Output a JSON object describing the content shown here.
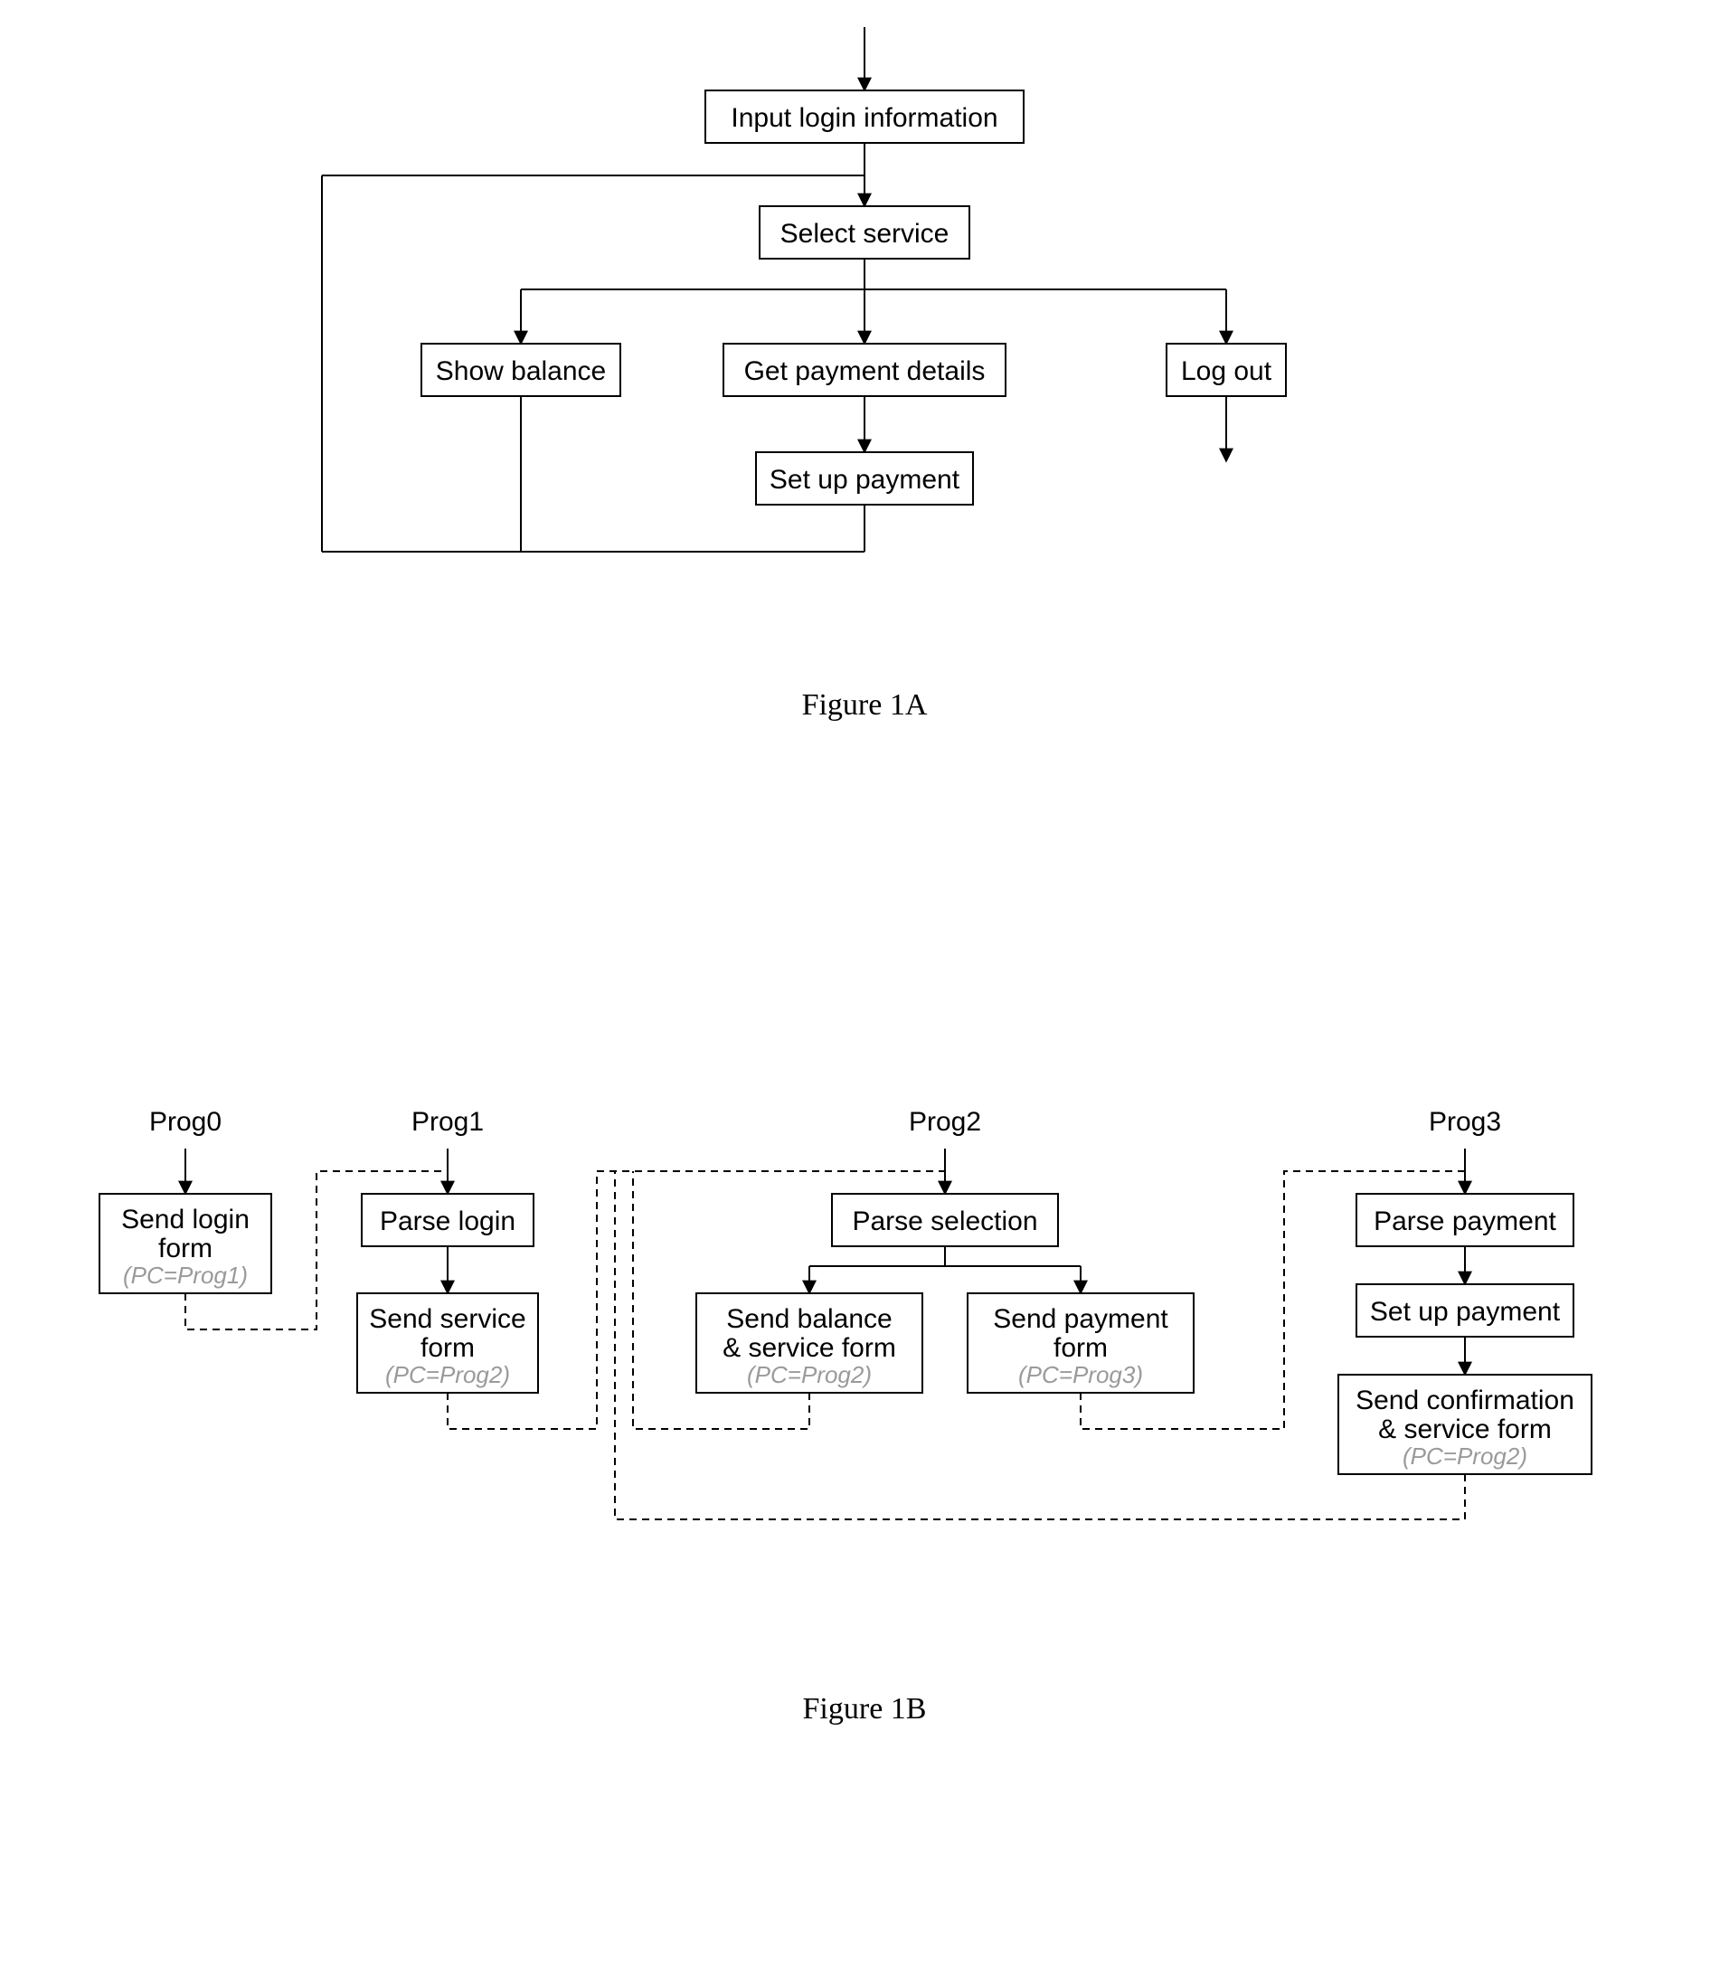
{
  "figA": {
    "caption": "Figure 1A",
    "nodes": {
      "login": "Input login information",
      "select": "Select service",
      "balance": "Show balance",
      "payDet": "Get payment details",
      "setup": "Set up payment",
      "logout": "Log out"
    }
  },
  "figB": {
    "caption": "Figure 1B",
    "progs": {
      "p0": "Prog0",
      "p1": "Prog1",
      "p2": "Prog2",
      "p3": "Prog3"
    },
    "nodes": {
      "p0_sendLogin": {
        "l1": "Send login",
        "l2": "form",
        "pc": "(PC=Prog1)"
      },
      "p1_parse": {
        "l1": "Parse login"
      },
      "p1_sendSvc": {
        "l1": "Send service",
        "l2": "form",
        "pc": "(PC=Prog2)"
      },
      "p2_parse": {
        "l1": "Parse selection"
      },
      "p2_balance": {
        "l1": "Send balance",
        "l2": "& service form",
        "pc": "(PC=Prog2)"
      },
      "p2_payForm": {
        "l1": "Send payment",
        "l2": "form",
        "pc": "(PC=Prog3)"
      },
      "p3_parse": {
        "l1": "Parse payment"
      },
      "p3_setup": {
        "l1": "Set up payment"
      },
      "p3_conf": {
        "l1": "Send confirmation",
        "l2": "& service form",
        "pc": "(PC=Prog2)"
      }
    }
  },
  "chart_data": [
    {
      "type": "flowchart",
      "figure": "1A",
      "nodes": [
        {
          "id": "login",
          "label": "Input login information"
        },
        {
          "id": "select",
          "label": "Select service"
        },
        {
          "id": "balance",
          "label": "Show balance"
        },
        {
          "id": "payDet",
          "label": "Get payment details"
        },
        {
          "id": "setup",
          "label": "Set up payment"
        },
        {
          "id": "logout",
          "label": "Log out"
        }
      ],
      "edges": [
        {
          "from": "_start",
          "to": "login"
        },
        {
          "from": "login",
          "to": "select"
        },
        {
          "from": "select",
          "to": "balance"
        },
        {
          "from": "select",
          "to": "payDet"
        },
        {
          "from": "select",
          "to": "logout"
        },
        {
          "from": "payDet",
          "to": "setup"
        },
        {
          "from": "balance",
          "to": "select",
          "loop_back": true
        },
        {
          "from": "setup",
          "to": "select",
          "loop_back": true
        },
        {
          "from": "logout",
          "to": "_end"
        }
      ]
    },
    {
      "type": "flowchart",
      "figure": "1B",
      "groups": [
        "Prog0",
        "Prog1",
        "Prog2",
        "Prog3"
      ],
      "nodes": [
        {
          "id": "p0_sendLogin",
          "group": "Prog0",
          "label": "Send login form",
          "pc": "Prog1"
        },
        {
          "id": "p1_parse",
          "group": "Prog1",
          "label": "Parse login"
        },
        {
          "id": "p1_sendSvc",
          "group": "Prog1",
          "label": "Send service form",
          "pc": "Prog2"
        },
        {
          "id": "p2_parse",
          "group": "Prog2",
          "label": "Parse selection"
        },
        {
          "id": "p2_balance",
          "group": "Prog2",
          "label": "Send balance & service form",
          "pc": "Prog2"
        },
        {
          "id": "p2_payForm",
          "group": "Prog2",
          "label": "Send payment form",
          "pc": "Prog3"
        },
        {
          "id": "p3_parse",
          "group": "Prog3",
          "label": "Parse payment"
        },
        {
          "id": "p3_setup",
          "group": "Prog3",
          "label": "Set up payment"
        },
        {
          "id": "p3_conf",
          "group": "Prog3",
          "label": "Send confirmation & service form",
          "pc": "Prog2"
        }
      ],
      "edges": [
        {
          "from": "_start_p0",
          "to": "p0_sendLogin",
          "style": "solid"
        },
        {
          "from": "_start_p1",
          "to": "p1_parse",
          "style": "solid"
        },
        {
          "from": "p1_parse",
          "to": "p1_sendSvc",
          "style": "solid"
        },
        {
          "from": "_start_p2",
          "to": "p2_parse",
          "style": "solid"
        },
        {
          "from": "p2_parse",
          "to": "p2_balance",
          "style": "solid"
        },
        {
          "from": "p2_parse",
          "to": "p2_payForm",
          "style": "solid"
        },
        {
          "from": "_start_p3",
          "to": "p3_parse",
          "style": "solid"
        },
        {
          "from": "p3_parse",
          "to": "p3_setup",
          "style": "solid"
        },
        {
          "from": "p3_setup",
          "to": "p3_conf",
          "style": "solid"
        },
        {
          "from": "p0_sendLogin",
          "to": "p1_parse",
          "style": "dashed",
          "meaning": "PC=Prog1"
        },
        {
          "from": "p1_sendSvc",
          "to": "p2_parse",
          "style": "dashed",
          "meaning": "PC=Prog2"
        },
        {
          "from": "p2_balance",
          "to": "p2_parse",
          "style": "dashed",
          "meaning": "PC=Prog2"
        },
        {
          "from": "p2_payForm",
          "to": "p3_parse",
          "style": "dashed",
          "meaning": "PC=Prog3"
        },
        {
          "from": "p3_conf",
          "to": "p2_parse",
          "style": "dashed",
          "meaning": "PC=Prog2"
        }
      ]
    }
  ]
}
